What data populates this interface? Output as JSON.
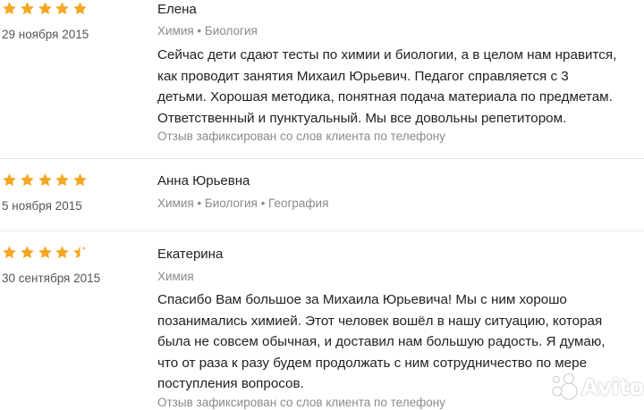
{
  "colors": {
    "star": "#f5a623",
    "muted": "#8a8a8a",
    "text": "#222222"
  },
  "reviews": [
    {
      "rating": 5,
      "date": "29 ноября 2015",
      "name": "Елена",
      "subjects": "Химия • Биология",
      "text_lines": [
        "Сейчас дети сдают тесты по химии и биологии, а в целом нам нравится,",
        "как проводит занятия Михаил Юрьевич. Педагог справляется с 3",
        "детьми. Хорошая методика, понятная подача материала по предметам.",
        "Ответственный и пунктуальный. Мы все довольны репетитором."
      ],
      "note": "Отзыв зафиксирован со слов клиента по телефону"
    },
    {
      "rating": 5,
      "date": "5 ноября 2015",
      "name": "Анна Юрьевна",
      "subjects": "Химия • Биология • География"
    },
    {
      "rating": 4.5,
      "date": "30 сентября 2015",
      "name": "Екатерина",
      "subjects": "Химия",
      "text_lines": [
        "Спасибо Вам большое за Михаила Юрьевича! Мы с ним хорошо",
        "позанимались химией. Этот человек вошёл в нашу ситуацию, которая",
        "была не совсем обычная, и доставил нам большую радость. Я думаю,",
        "что от раза к разу будем продолжать с ним сотрудничество по мере",
        "поступления вопросов."
      ],
      "note": "Отзыв зафиксирован со слов клиента по телефону"
    }
  ],
  "watermark": {
    "text": "Avito",
    "icon": "avito-logo-icon"
  }
}
